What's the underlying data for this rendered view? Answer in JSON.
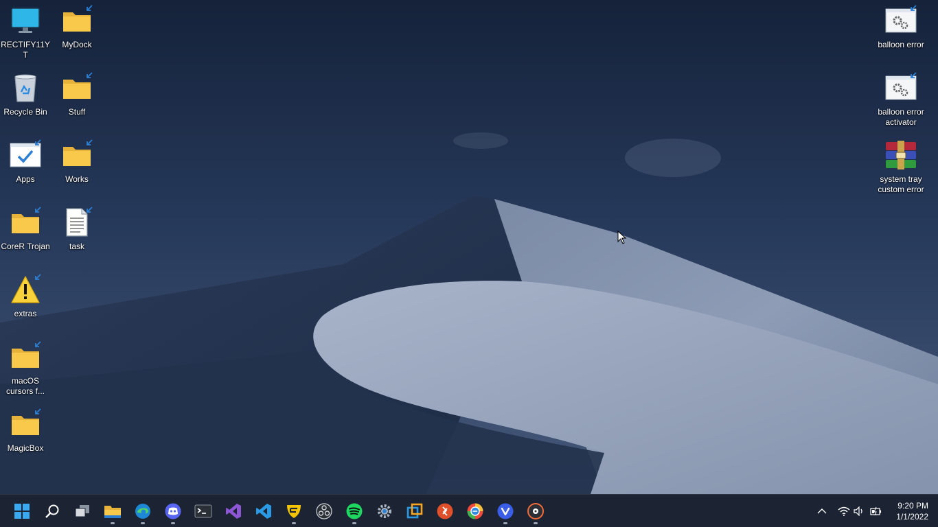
{
  "desktop": {
    "icons_left": [
      {
        "label": "RECTIFY11YT",
        "icon": "monitor-icon"
      },
      {
        "label": "MyDock",
        "icon": "folder-icon"
      },
      {
        "label": "Recycle Bin",
        "icon": "recycle-bin-icon"
      },
      {
        "label": "Stuff",
        "icon": "folder-icon"
      },
      {
        "label": "Apps",
        "icon": "checkmark-window-icon"
      },
      {
        "label": "Works",
        "icon": "folder-icon"
      },
      {
        "label": "CoreR Trojan",
        "icon": "folder-icon"
      },
      {
        "label": "task",
        "icon": "text-file-icon"
      },
      {
        "label": "extras",
        "icon": "warning-icon"
      },
      {
        "label": "macOS cursors f...",
        "icon": "folder-icon"
      },
      {
        "label": "MagicBox",
        "icon": "folder-icon"
      }
    ],
    "icons_right": [
      {
        "label": "balloon error",
        "icon": "settings-window-icon"
      },
      {
        "label": "balloon error activator",
        "icon": "settings-window-icon"
      },
      {
        "label": "system tray custom error",
        "icon": "winrar-archive-icon"
      }
    ]
  },
  "taskbar": {
    "apps": [
      {
        "name": "start-button",
        "icon": "windows-logo-icon",
        "running": false
      },
      {
        "name": "search-button",
        "icon": "search-icon",
        "running": false
      },
      {
        "name": "task-view-button",
        "icon": "task-view-icon",
        "running": false
      },
      {
        "name": "file-explorer-button",
        "icon": "file-explorer-icon",
        "running": true
      },
      {
        "name": "edge-button",
        "icon": "edge-icon",
        "running": true
      },
      {
        "name": "discord-button",
        "icon": "discord-icon",
        "running": true
      },
      {
        "name": "terminal-button",
        "icon": "terminal-icon",
        "running": false
      },
      {
        "name": "visual-studio-button",
        "icon": "visual-studio-icon",
        "running": false
      },
      {
        "name": "vscode-button",
        "icon": "vscode-icon",
        "running": false
      },
      {
        "name": "guilded-button",
        "icon": "guilded-icon",
        "running": true
      },
      {
        "name": "obs-button",
        "icon": "obs-icon",
        "running": false
      },
      {
        "name": "spotify-button",
        "icon": "spotify-icon",
        "running": true
      },
      {
        "name": "settings-button",
        "icon": "gear-icon",
        "running": false
      },
      {
        "name": "vmware-button",
        "icon": "vmware-icon",
        "running": false
      },
      {
        "name": "remote-desktop-button",
        "icon": "remote-desktop-icon",
        "running": false
      },
      {
        "name": "browser-button",
        "icon": "browser-icon",
        "running": false
      },
      {
        "name": "vivaldi-button",
        "icon": "vivaldi-icon",
        "running": true
      },
      {
        "name": "media-player-button",
        "icon": "media-player-icon",
        "running": true
      }
    ],
    "tray": {
      "icons": [
        "chevron-up-icon",
        "wifi-icon",
        "volume-icon",
        "battery-icon"
      ],
      "time": "9:20 PM",
      "date": "1/1/2022"
    }
  },
  "colors": {
    "taskbar_bg": "#1c2433",
    "folder_yellow": "#f8c94a",
    "accent_blue": "#2d7fd4"
  }
}
